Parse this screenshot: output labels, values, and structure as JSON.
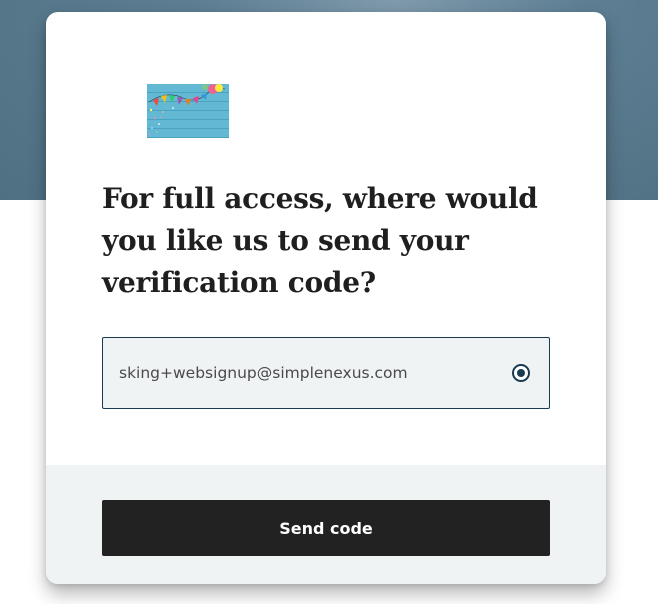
{
  "logo": {
    "icon": "party-banner-logo-icon"
  },
  "heading": "For full access, where would you like us to send your verification code?",
  "verification_option": {
    "value": "sking+websignup@simplenexus.com",
    "selected": true,
    "icon": "radio-selected-icon"
  },
  "send_button": {
    "label": "Send code"
  },
  "colors": {
    "hero_band": "#557689",
    "accent": "#193a52",
    "button": "#222222",
    "footer": "#f0f3f4"
  }
}
